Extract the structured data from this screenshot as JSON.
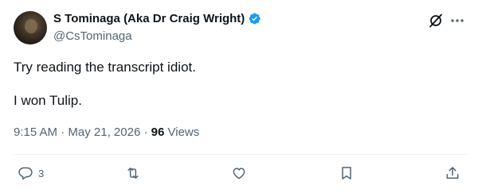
{
  "author": {
    "display_name": "S Tominaga (Aka Dr Craig Wright)",
    "handle": "@CsTominaga",
    "verified": true,
    "verified_color": "#1d9bf0"
  },
  "tweet": {
    "text": "Try reading the transcript idiot.\n\nI won Tulip.",
    "time": "9:15 AM",
    "separator": "·",
    "date": "May 21, 2026",
    "views_count": "96",
    "views_label": "Views"
  },
  "actions": {
    "reply_count": "3",
    "reply_icon": "reply-icon",
    "retweet_icon": "retweet-icon",
    "like_icon": "heart-icon",
    "bookmark_icon": "bookmark-icon",
    "share_icon": "share-icon"
  },
  "colors": {
    "text_primary": "#0f1419",
    "text_secondary": "#536471",
    "divider": "#eff3f4"
  }
}
